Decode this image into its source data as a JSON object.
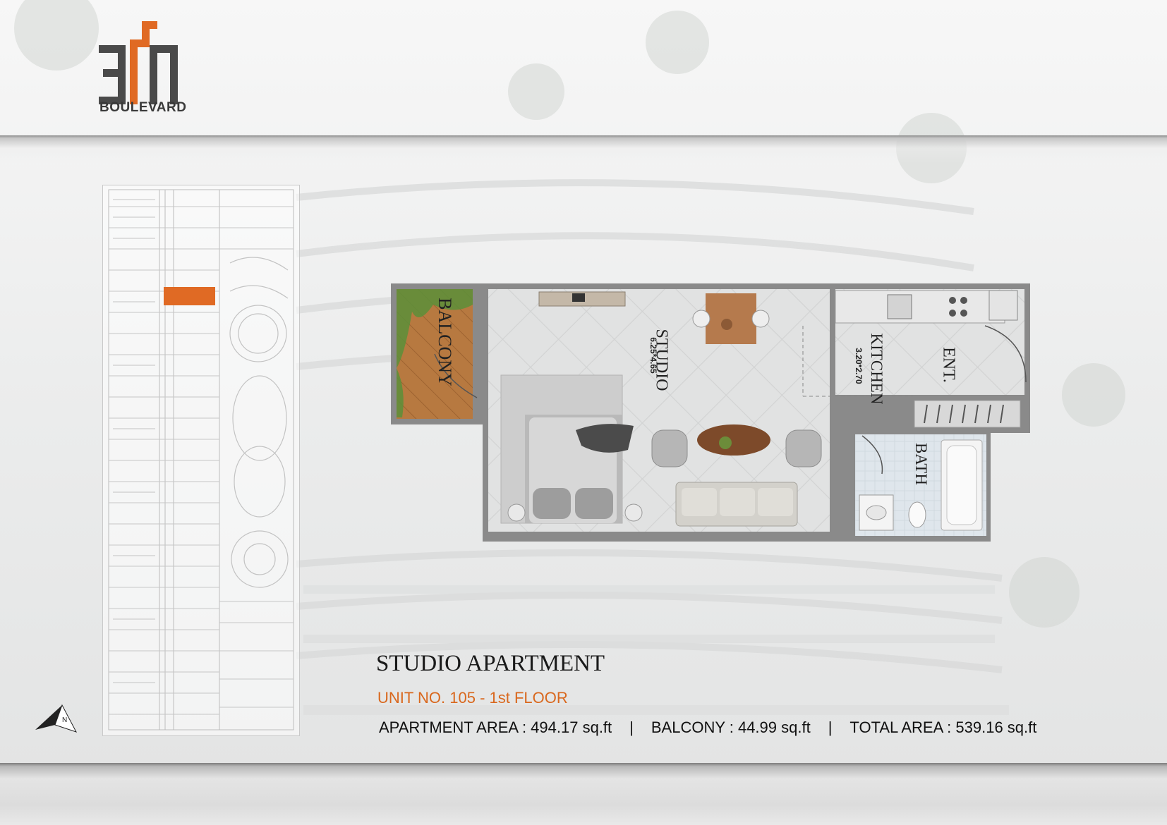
{
  "brand": {
    "name": "BOULEVARD",
    "mark_description": "311 logo mark"
  },
  "plan": {
    "title": "STUDIO APARTMENT",
    "unit": "UNIT NO. 105 - 1st FLOOR",
    "apartment_area": "APARTMENT AREA : 494.17 sq.ft",
    "separator": "|",
    "balcony_area": "BALCONY : 44.99 sq.ft",
    "total_area": "TOTAL AREA : 539.16 sq.ft"
  },
  "rooms": {
    "balcony": "BALCONY",
    "studio": "STUDIO",
    "studio_dim": "6.25*4.65",
    "kitchen": "KITCHEN",
    "kitchen_dim": "3.20*2.70",
    "entrance": "ENT.",
    "bath": "BATH"
  },
  "colors": {
    "accent": "#d9681e",
    "wall": "#8a8a8a",
    "floor": "#e3e4e4",
    "balcony_floor": "#b9773f",
    "highlight_unit": "#e06a24"
  },
  "icons": [
    "north-arrow-icon",
    "logo-mark"
  ]
}
